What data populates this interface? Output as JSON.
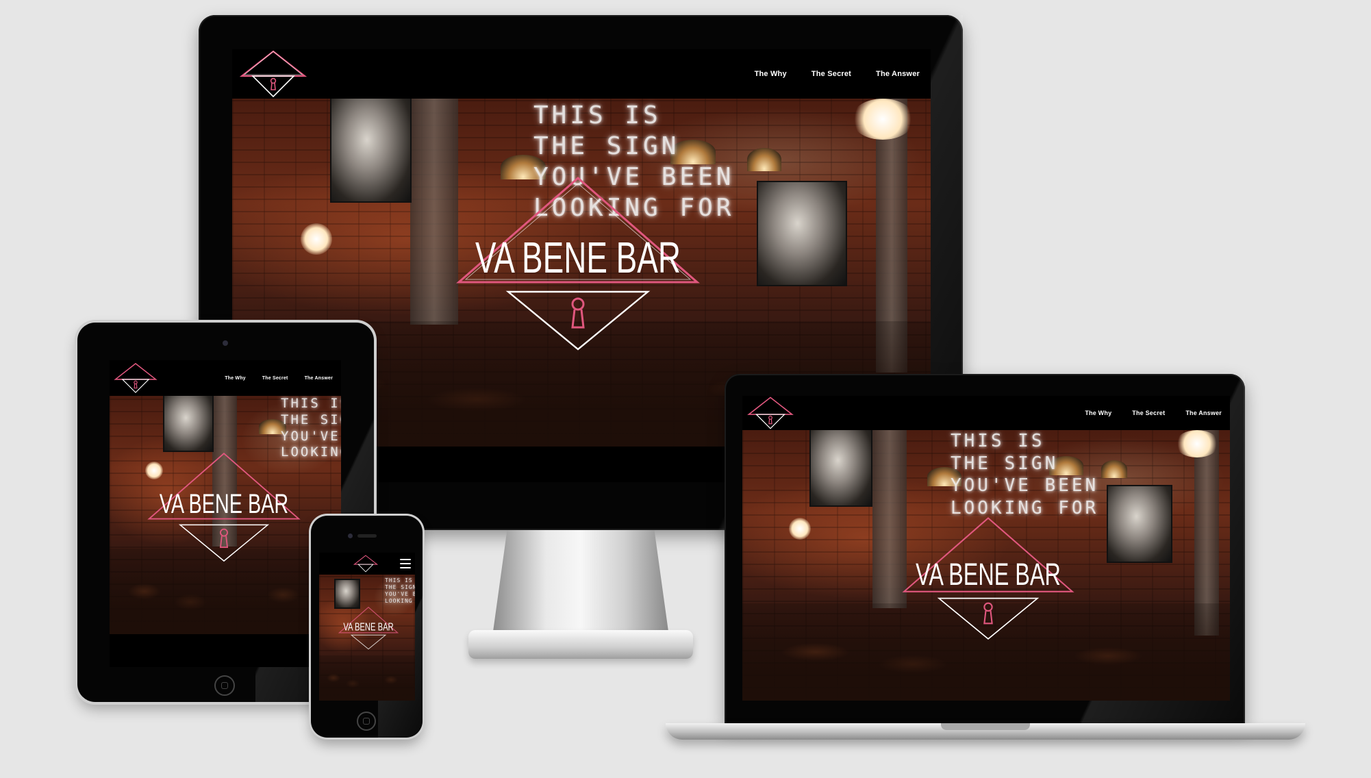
{
  "site": {
    "brand": "VA BENE BAR",
    "neon_lines": [
      "THIS IS",
      "THE SIGN",
      "YOU'VE BEEN",
      "LOOKING FOR"
    ],
    "nav": [
      {
        "label": "The Why"
      },
      {
        "label": "The Secret"
      },
      {
        "label": "The Answer"
      }
    ]
  },
  "devices": [
    "desktop-monitor",
    "tablet",
    "laptop",
    "phone"
  ],
  "colors": {
    "background": "#e6e6e6",
    "header": "#000000",
    "nav_text": "#ffffff",
    "neon_pink": "#e0577e",
    "neon_white": "#f4f4f4",
    "brick": "#6b2c18"
  },
  "icons": {
    "logo": "diamond-keyhole-logo-icon",
    "menu": "hamburger-menu-icon",
    "keyhole": "keyhole-icon"
  }
}
